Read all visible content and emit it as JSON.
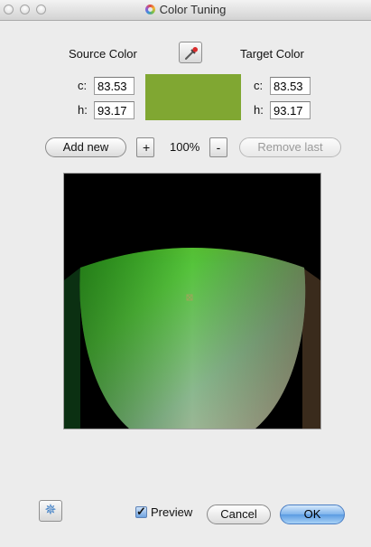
{
  "window": {
    "title": "Color Tuning"
  },
  "source": {
    "label": "Source Color",
    "c_label": "c:",
    "c_value": "83.53",
    "h_label": "h:",
    "h_value": "93.17"
  },
  "target": {
    "label": "Target Color",
    "c_label": "c:",
    "c_value": "83.53",
    "h_label": "h:",
    "h_value": "93.17"
  },
  "swatch_color": "#80a732",
  "toolbar": {
    "add_new": "Add new",
    "zoom_in": "+",
    "zoom_level": "100%",
    "zoom_out": "-",
    "remove_last": "Remove last"
  },
  "footer": {
    "preview_label": "Preview",
    "preview_checked": true,
    "cancel": "Cancel",
    "ok": "OK"
  },
  "icons": {
    "picker": "eyedropper-icon",
    "settings": "gear-icon",
    "app": "color-wheel-icon"
  }
}
